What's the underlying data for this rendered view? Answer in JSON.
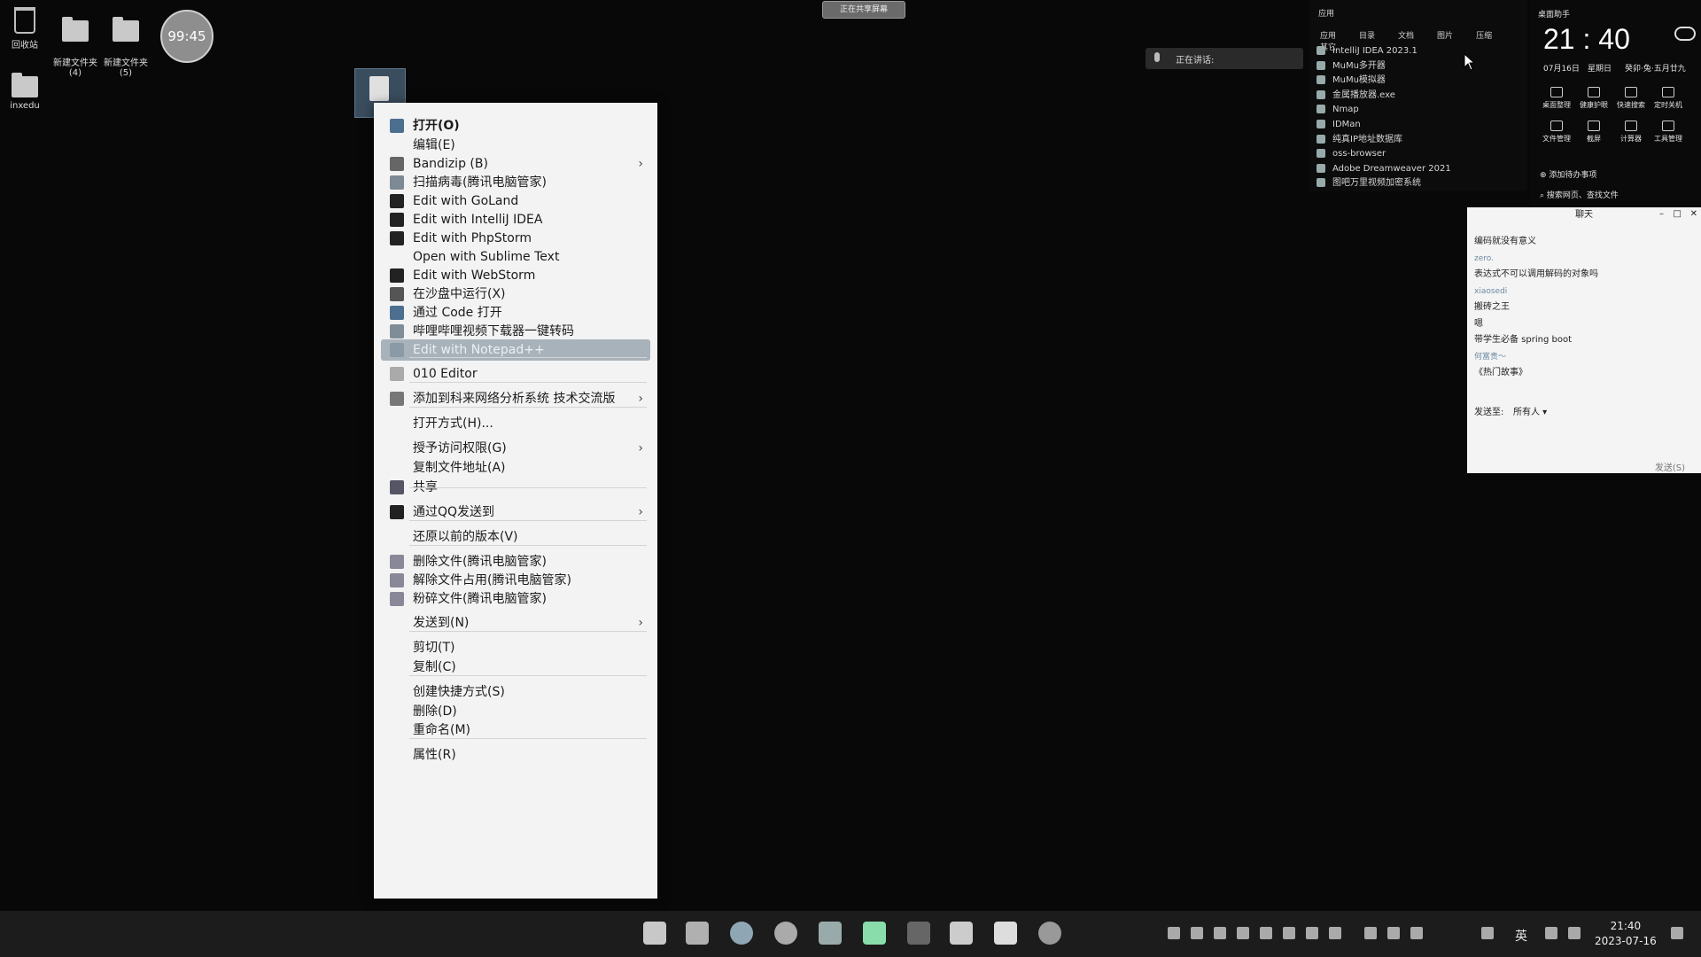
{
  "desktop": {
    "icons": [
      {
        "label": "回收站"
      },
      {
        "label": "新建文件夹\n(4)"
      },
      {
        "label": "新建文件夹\n(5)"
      },
      {
        "label": "inxedu"
      }
    ],
    "timer": "99:45",
    "top_pill": "正在共享屏幕"
  },
  "context_menu": {
    "items": [
      {
        "label": "打开(O)",
        "icon": "vscode-icon",
        "color": "#4d6f8f"
      },
      {
        "label": "编辑(E)"
      },
      {
        "label": "Bandizip (B)",
        "icon": "bandizip-icon",
        "color": "#666",
        "submenu": "›"
      },
      {
        "label": "扫描病毒(腾讯电脑管家)",
        "icon": "scan-virus-icon",
        "color": "#7d8a95"
      },
      {
        "label": "Edit with GoLand",
        "icon": "goland-icon",
        "color": "#222"
      },
      {
        "label": "Edit with IntelliJ IDEA",
        "icon": "intellij-icon",
        "color": "#222"
      },
      {
        "label": "Edit with PhpStorm",
        "icon": "phpstorm-icon",
        "color": "#222"
      },
      {
        "label": "Open with Sublime Text"
      },
      {
        "label": "Edit with WebStorm",
        "icon": "webstorm-icon",
        "color": "#222"
      },
      {
        "label": "在沙盘中运行(X)",
        "icon": "sandbox-icon",
        "color": "#555"
      },
      {
        "label": "通过 Code 打开",
        "icon": "vscode-icon",
        "color": "#4d6f8f"
      },
      {
        "label": "哔哩哔哩视频下载器一键转码",
        "icon": "bilibili-icon",
        "color": "#7f8d99"
      },
      {
        "label": "Edit with Notepad++",
        "icon": "notepad-icon",
        "color": "#8a9aa6",
        "highlighted": true
      },
      {
        "label": "010 Editor",
        "icon": "010-editor-icon",
        "color": "#aaa"
      },
      {
        "label": "添加到科来网络分析系统 技术交流版",
        "icon": "colasoft-icon",
        "color": "#777",
        "submenu": "›"
      },
      {
        "label": "打开方式(H)..."
      },
      {
        "label": "授予访问权限(G)",
        "submenu": "›"
      },
      {
        "label": "复制文件地址(A)"
      },
      {
        "label": "共享",
        "icon": "share-icon",
        "color": "#556"
      },
      {
        "label": "通过QQ发送到",
        "icon": "qq-icon",
        "color": "#222",
        "submenu": "›"
      },
      {
        "label": "还原以前的版本(V)"
      },
      {
        "label": "删除文件(腾讯电脑管家)",
        "icon": "delete-file-icon",
        "color": "#889"
      },
      {
        "label": "解除文件占用(腾讯电脑管家)",
        "icon": "unlock-file-icon",
        "color": "#889"
      },
      {
        "label": "粉碎文件(腾讯电脑管家)",
        "icon": "shred-file-icon",
        "color": "#889"
      },
      {
        "label": "发送到(N)",
        "submenu": "›"
      },
      {
        "label": "剪切(T)"
      },
      {
        "label": "复制(C)"
      },
      {
        "label": "创建快捷方式(S)"
      },
      {
        "label": "删除(D)"
      },
      {
        "label": "重命名(M)"
      },
      {
        "label": "属性(R)"
      }
    ]
  },
  "voice": {
    "label": "正在讲话:"
  },
  "apps": {
    "header": "应用",
    "tabs": [
      "应用",
      "目录",
      "文档",
      "图片",
      "压缩",
      "其它"
    ],
    "items": [
      "IntelliJ IDEA 2023.1",
      "MuMu多开器",
      "MuMu模拟器",
      "金属播放器.exe",
      "Nmap",
      "IDMan",
      "纯真IP地址数据库",
      "oss-browser",
      "Adobe Dreamweaver 2021",
      "图吧万里视频加密系统"
    ]
  },
  "assistant": {
    "title": "桌面助手",
    "time": "21 : 40",
    "date": "07月16日",
    "weekday": "星期日",
    "lunar": "癸卯·兔·五月廿九",
    "tools": [
      "桌面整理",
      "健康护眼",
      "快速搜索",
      "定时关机",
      "文件管理",
      "截屏",
      "计算器",
      "工具管理"
    ],
    "todo": "添加待办事项",
    "search": "搜索网页、查找文件"
  },
  "chat": {
    "title": "聊天",
    "messages": [
      {
        "text": "编码就没有意义",
        "nick": false
      },
      {
        "text": "zero.",
        "nick": true
      },
      {
        "text": "表达式不可以调用解码的对象吗",
        "nick": false
      },
      {
        "text": "xiaosedi",
        "nick": true
      },
      {
        "text": "搬砖之王",
        "nick": false
      },
      {
        "text": "嗯",
        "nick": false
      },
      {
        "text": "带学生必备 spring boot",
        "nick": false
      },
      {
        "text": "何富贵～",
        "nick": true
      },
      {
        "text": "《热门故事》",
        "nick": false
      }
    ],
    "send_to_label": "发送至:",
    "send_to_value": "所有人",
    "send_button": "发送(S)"
  },
  "taskbar": {
    "time": "21:40",
    "date": "2023-07-16",
    "ime": "英"
  }
}
